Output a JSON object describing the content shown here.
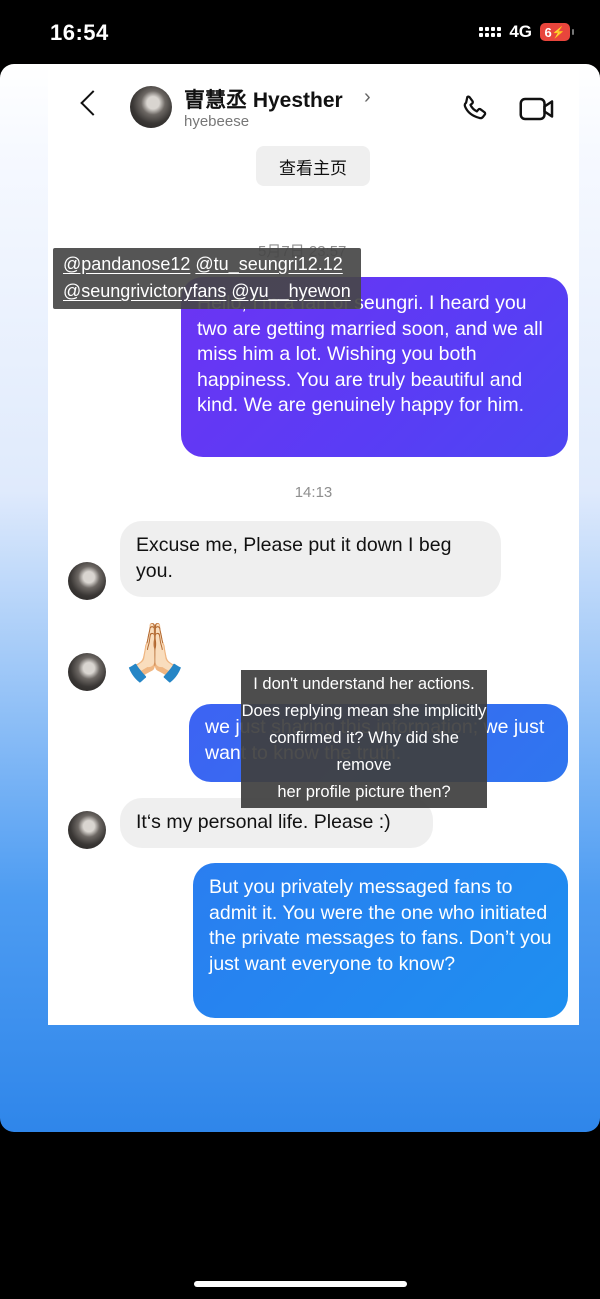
{
  "status_bar": {
    "time": "16:54",
    "network": "4G",
    "battery_label": "6"
  },
  "chat": {
    "header": {
      "contact_name": "曺慧丞 Hyesther",
      "name_chevron": "›",
      "contact_handle": "hyebeese",
      "icons": [
        "back-icon",
        "avatar",
        "phone-icon",
        "video-camera-icon"
      ]
    },
    "view_profile_label": "查看主页",
    "date_stamp": "5月7日 23:57",
    "time_stamp": "14:13",
    "messages": [
      {
        "direction": "sent",
        "text": "Hello, I’m a fan of seungri. I heard you two are getting married soon, and we all miss him a lot. Wishing you both happiness. You are truly beautiful and kind. We are genuinely happy for him."
      },
      {
        "direction": "received",
        "text": "Excuse me, Please put it down I beg you."
      },
      {
        "direction": "received",
        "text": "🙏🏻"
      },
      {
        "direction": "sent",
        "text": "we just sharing this information; we just want to know the truth."
      },
      {
        "direction": "received",
        "text": "It‘s my personal life. Please :)"
      },
      {
        "direction": "sent",
        "text": "But you privately messaged fans to admit it. You were the one who initiated the private messages to fans. Don’t you just want everyone to know?"
      }
    ]
  },
  "overlays": {
    "tags": [
      "@pandanose12",
      "@tu_seungri12.12",
      "@seungrivictoryfans",
      "@yu__hyewon"
    ],
    "caption_lines": [
      "I don't understand her actions.",
      "Does replying mean she implicitly",
      "confirmed it? Why did she remove",
      "her profile picture then?"
    ]
  },
  "colors": {
    "sent_gradient_top": "#6c34f3",
    "sent_gradient_bottom": "#1e8ff0",
    "received_bubble": "#efefef",
    "story_background_bottom": "#2f86ea"
  }
}
